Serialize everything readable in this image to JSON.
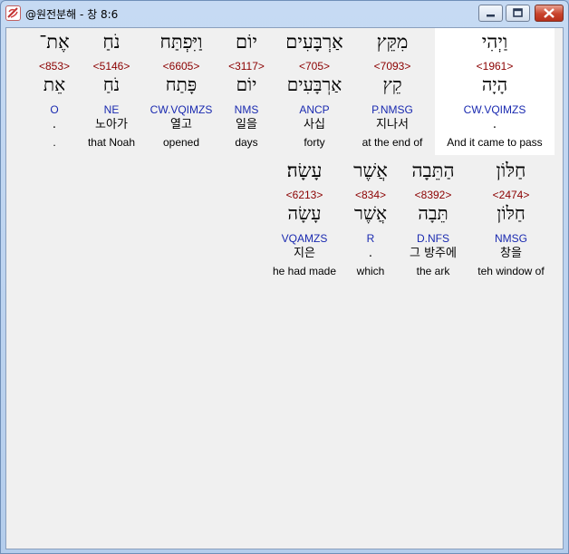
{
  "window": {
    "title": "@원전분해 - 창 8:6",
    "colors": {
      "highlight": "#ffffff",
      "code_color": "#8b0000",
      "morph_color": "#1a2ab0"
    }
  },
  "verse": {
    "rows": [
      {
        "words": [
          {
            "hebrew": "וַיְהִי",
            "strong": "<1961>",
            "lemma": "הָיָה",
            "morph": "CW.VQIMZS",
            "korean": ".",
            "english": "And it came to pass",
            "highlighted": true
          },
          {
            "hebrew": "מִקֵּץ",
            "strong": "<7093>",
            "lemma": "קֵץ",
            "morph": "P.NMSG",
            "korean": "지나서",
            "english": "at the end of"
          },
          {
            "hebrew": "אַרְבָּעִים",
            "strong": "<705>",
            "lemma": "אַרְבָּעִים",
            "morph": "ANCP",
            "korean": "사십",
            "english": "forty"
          },
          {
            "hebrew": "יוֹם",
            "strong": "<3117>",
            "lemma": "יוֹם",
            "morph": "NMS",
            "korean": "일을",
            "english": "days"
          },
          {
            "hebrew": "וַיִּפְתַּח",
            "strong": "<6605>",
            "lemma": "פָּתַח",
            "morph": "CW.VQIMZS",
            "korean": "열고",
            "english": "opened"
          },
          {
            "hebrew": "נֹחַ",
            "strong": "<5146>",
            "lemma": "נֹחַ",
            "morph": "NE",
            "korean": "노아가",
            "english": "that Noah"
          },
          {
            "hebrew": "אֶת־",
            "strong": "<853>",
            "lemma": "אֵת",
            "morph": "O",
            "korean": ".",
            "english": "."
          }
        ]
      },
      {
        "words": [
          {
            "hebrew": "חַלּוֹן",
            "strong": "<2474>",
            "lemma": "חַלּוֹן",
            "morph": "NMSG",
            "korean": "창을",
            "english": "teh window of"
          },
          {
            "hebrew": "הַתֵּבָה",
            "strong": "<8392>",
            "lemma": "תֵּבָה",
            "morph": "D.NFS",
            "korean": "그 방주에",
            "english": "the ark"
          },
          {
            "hebrew": "אֲשֶׁר",
            "strong": "<834>",
            "lemma": "אֲשֶׁר",
            "morph": "R",
            "korean": ".",
            "english": "which"
          },
          {
            "hebrew": "עָשָׂה׃",
            "strong": "<6213>",
            "lemma": "עָשָׂה",
            "morph": "VQAMZS",
            "korean": "지은",
            "english": "he had made"
          }
        ]
      }
    ]
  }
}
